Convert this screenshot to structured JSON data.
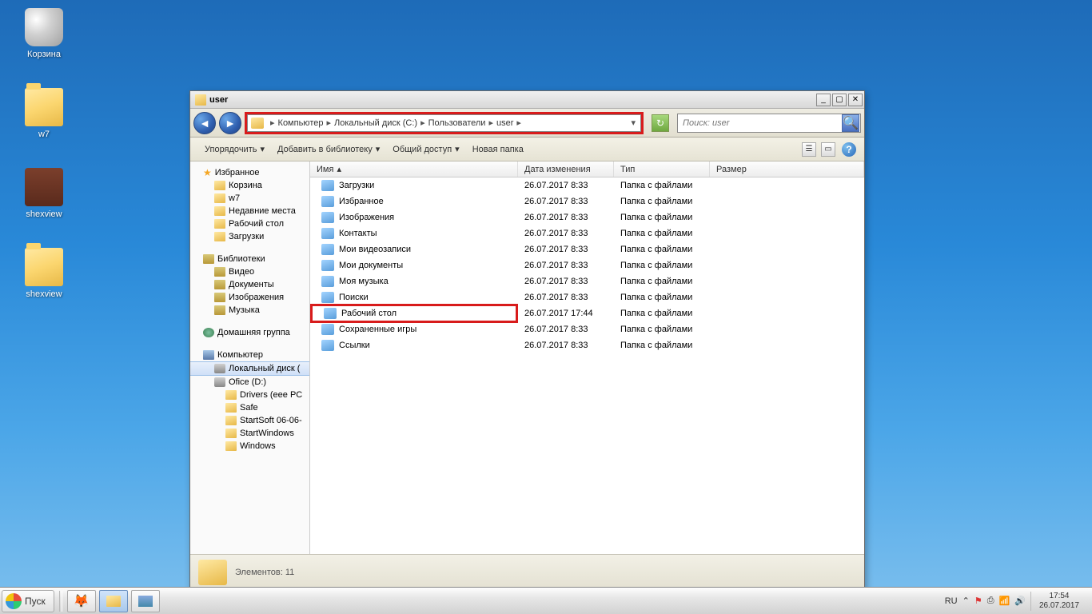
{
  "desktop_icons": [
    {
      "label": "Корзина",
      "kind": "recycle",
      "name": "recycle-bin"
    },
    {
      "label": "w7",
      "kind": "folder",
      "name": "folder-w7"
    },
    {
      "label": "shexview",
      "kind": "winrar",
      "name": "archive-shexview"
    },
    {
      "label": "shexview",
      "kind": "folder",
      "name": "folder-shexview"
    }
  ],
  "window": {
    "title": "user",
    "breadcrumb": [
      "Компьютер",
      "Локальный диск (C:)",
      "Пользователи",
      "user"
    ],
    "search_placeholder": "Поиск: user"
  },
  "toolbar": {
    "organize": "Упорядочить",
    "library": "Добавить в библиотеку",
    "share": "Общий доступ",
    "newfolder": "Новая папка"
  },
  "nav": {
    "favorites": "Избранное",
    "fav_items": [
      "Корзина",
      "w7",
      "Недавние места",
      "Рабочий стол",
      "Загрузки"
    ],
    "libraries": "Библиотеки",
    "lib_items": [
      "Видео",
      "Документы",
      "Изображения",
      "Музыка"
    ],
    "homegroup": "Домашняя группа",
    "computer": "Компьютер",
    "disks": [
      "Локальный диск (",
      "Ofice (D:)"
    ],
    "d_children": [
      "Drivers (eee PC",
      "Safe",
      "StartSoft 06-06-",
      "StartWindows",
      "Windows"
    ]
  },
  "columns": {
    "name": "Имя",
    "date": "Дата изменения",
    "type": "Тип",
    "size": "Размер"
  },
  "files": [
    {
      "name": "Загрузки",
      "date": "26.07.2017 8:33",
      "type": "Папка с файлами",
      "kind": "special"
    },
    {
      "name": "Избранное",
      "date": "26.07.2017 8:33",
      "type": "Папка с файлами",
      "kind": "special"
    },
    {
      "name": "Изображения",
      "date": "26.07.2017 8:33",
      "type": "Папка с файлами",
      "kind": "special"
    },
    {
      "name": "Контакты",
      "date": "26.07.2017 8:33",
      "type": "Папка с файлами",
      "kind": "special"
    },
    {
      "name": "Мои видеозаписи",
      "date": "26.07.2017 8:33",
      "type": "Папка с файлами",
      "kind": "special"
    },
    {
      "name": "Мои документы",
      "date": "26.07.2017 8:33",
      "type": "Папка с файлами",
      "kind": "special"
    },
    {
      "name": "Моя музыка",
      "date": "26.07.2017 8:33",
      "type": "Папка с файлами",
      "kind": "special"
    },
    {
      "name": "Поиски",
      "date": "26.07.2017 8:33",
      "type": "Папка с файлами",
      "kind": "special"
    },
    {
      "name": "Рабочий стол",
      "date": "26.07.2017 17:44",
      "type": "Папка с файлами",
      "kind": "special",
      "highlight": true
    },
    {
      "name": "Сохраненные игры",
      "date": "26.07.2017 8:33",
      "type": "Папка с файлами",
      "kind": "special"
    },
    {
      "name": "Ссылки",
      "date": "26.07.2017 8:33",
      "type": "Папка с файлами",
      "kind": "special"
    }
  ],
  "status": "Элементов: 11",
  "taskbar": {
    "start": "Пуск",
    "lang": "RU",
    "time": "17:54",
    "date": "26.07.2017"
  }
}
